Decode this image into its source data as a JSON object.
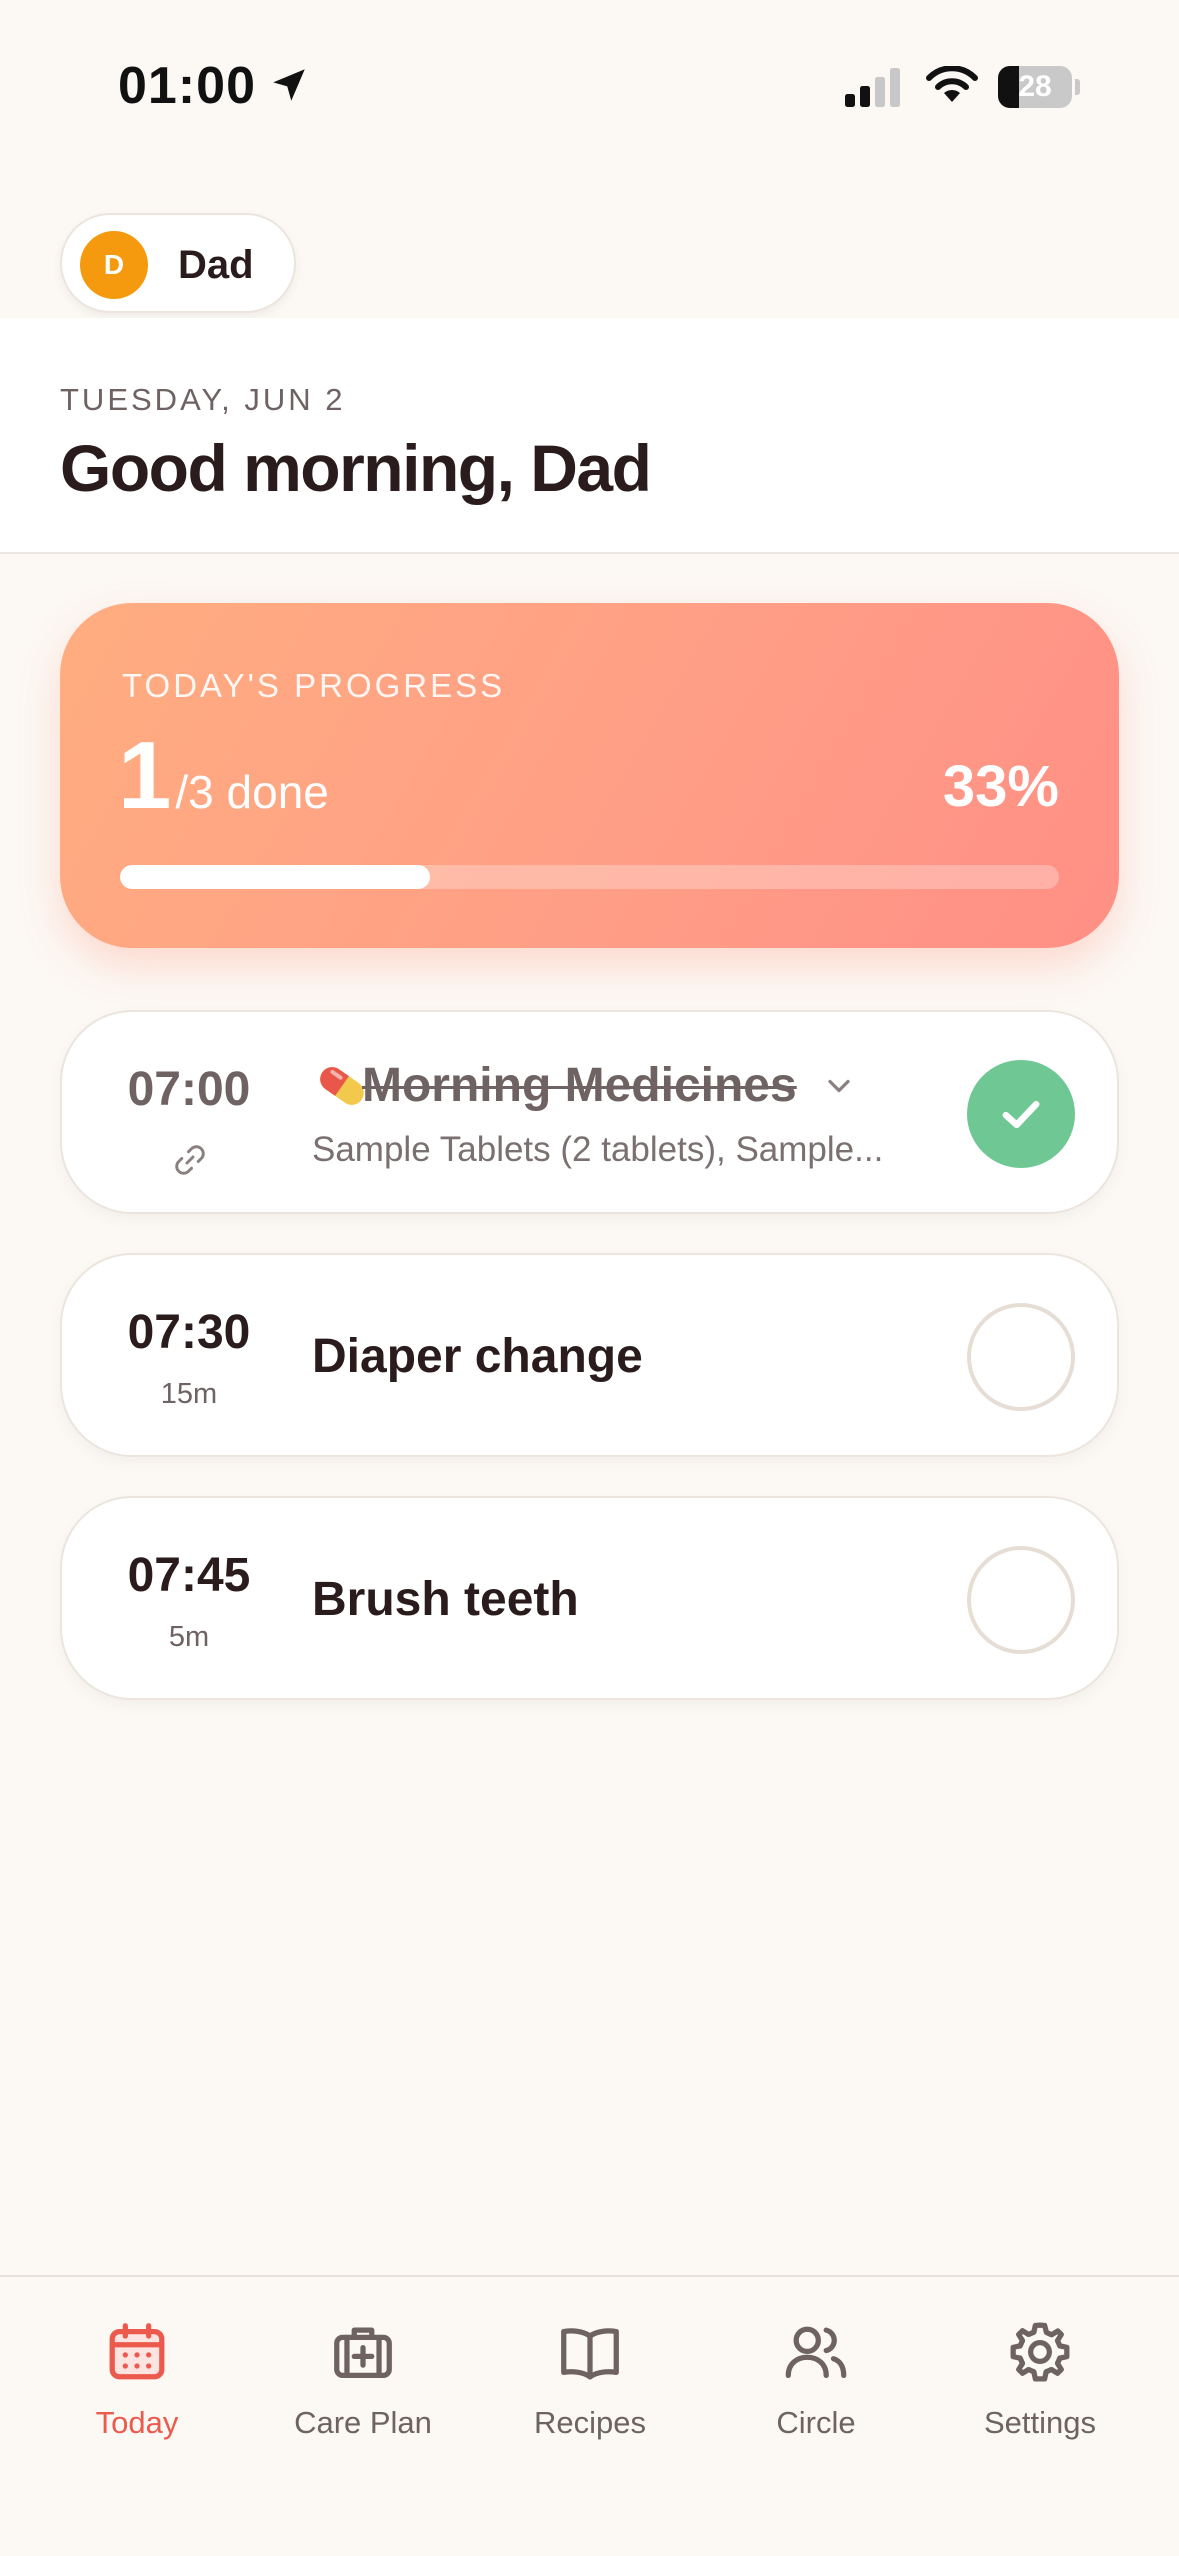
{
  "status_bar": {
    "time": "01:00",
    "battery_level": "28",
    "icons": [
      "location-arrow-icon",
      "cellular-signal-icon",
      "wifi-icon",
      "battery-icon"
    ]
  },
  "profile": {
    "initial": "D",
    "name": "Dad",
    "avatar_color": "#f59a0e"
  },
  "header": {
    "date": "TUESDAY, JUN 2",
    "greeting": "Good morning, Dad"
  },
  "progress": {
    "label": "TODAY'S PROGRESS",
    "done": "1",
    "total_suffix": "/3 done",
    "percent": "33%",
    "fraction": 0.33
  },
  "tasks": [
    {
      "time": "07:00",
      "title": "Morning Medicines",
      "subtitle": "Sample Tablets (2 tablets), Sample...",
      "icon": "pill-icon",
      "completed": true
    },
    {
      "time": "07:30",
      "duration": "15m",
      "title": "Diaper change",
      "completed": false
    },
    {
      "time": "07:45",
      "duration": "5m",
      "title": "Brush teeth",
      "completed": false
    }
  ],
  "tab_bar": {
    "items": [
      {
        "label": "Today",
        "icon": "calendar-icon",
        "active": true
      },
      {
        "label": "Care Plan",
        "icon": "medical-kit-icon",
        "active": false
      },
      {
        "label": "Recipes",
        "icon": "book-icon",
        "active": false
      },
      {
        "label": "Circle",
        "icon": "users-icon",
        "active": false
      },
      {
        "label": "Settings",
        "icon": "gear-icon",
        "active": false
      }
    ]
  },
  "colors": {
    "accent": "#ec5a4e",
    "success": "#6fc894",
    "background": "#fcf8f4",
    "progress_gradient_start": "#ffad80",
    "progress_gradient_end": "#ff8f85"
  }
}
